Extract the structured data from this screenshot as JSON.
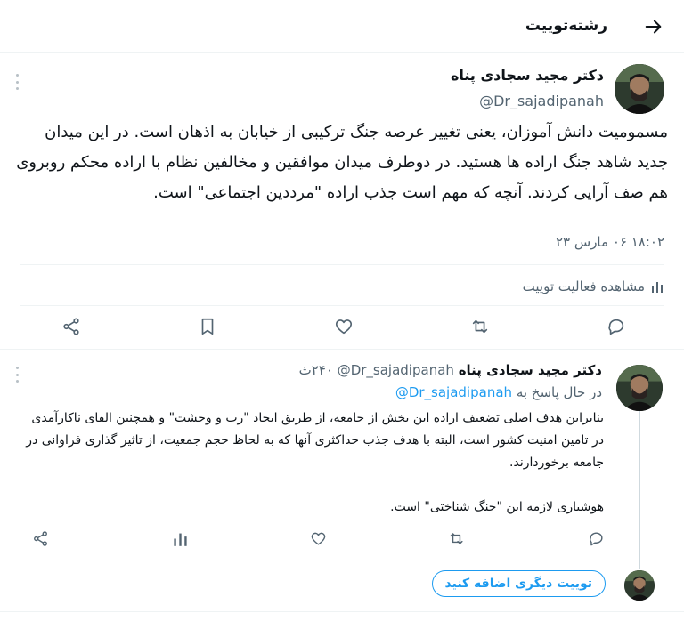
{
  "header": {
    "title": "رشته‌توییت",
    "back_icon": "arrow-right-icon"
  },
  "main_tweet": {
    "author_name": "دکتر مجید سجادی پناه",
    "handle": "@Dr_sajadipanah",
    "text": "مسمومیت دانش آموزان، یعنی تغییر عرصه جنگ ترکیبی از خیابان به اذهان است. در این میدان جدید شاهد جنگ اراده ها هستید. در دوطرف میدان موافقین و مخالفین نظام با اراده محکم روبروی هم صف آرایی کردند. آنچه که مهم است جذب اراده \"مرددین اجتماعی\" است.",
    "timestamp": "۱۸:۰۲ ۰۶ مارس ۲۳",
    "view_activity": "مشاهده فعالیت توییت",
    "actions": [
      "reply-icon",
      "retweet-icon",
      "like-icon",
      "bookmark-icon",
      "share-icon"
    ]
  },
  "reply_tweet": {
    "author_name": "دکتر مجید سجادی پناه",
    "handle": "@Dr_sajadipanah",
    "time": "۲۴۰ث",
    "replying_to_label": "در حال پاسخ به",
    "replying_to_handle": "@Dr_sajadipanah",
    "paragraph1": "بنابراین هدف اصلی تضعیف اراده این بخش از جامعه، از طریق ایجاد \"رب و وحشت\" و همچنین القای ناکارآمدی در تامین امنیت کشور است، البته با هدف جذب حداکثری آنها که به لحاظ حجم جمعیت، از تاثیر گذاری فراوانی در جامعه برخوردارند.",
    "paragraph2": "هوشیاری لازمه این \"جنگ شناختی\" است.",
    "actions": [
      "reply-icon",
      "retweet-icon",
      "like-icon",
      "views-icon",
      "share-icon"
    ]
  },
  "add_tweet": {
    "label": "توییت دیگری اضافه کنید"
  },
  "colors": {
    "accent": "#1d9bf0",
    "text_primary": "#0f1419",
    "text_secondary": "#536471",
    "divider": "#eff3f4"
  }
}
